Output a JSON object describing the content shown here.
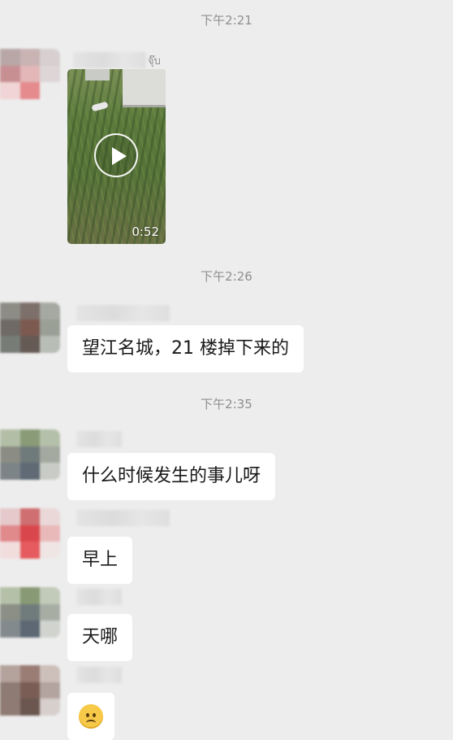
{
  "chat": {
    "timestamps": [
      "下午2:21",
      "下午2:26",
      "下午2:35"
    ],
    "video_message": {
      "sender_tag": "จุ๊บ",
      "duration": "0:52",
      "play_icon": "play-icon"
    },
    "messages": [
      {
        "text": "望江名城，21 楼掉下来的"
      },
      {
        "text": "什么时候发生的事儿呀"
      },
      {
        "text": "早上"
      },
      {
        "text": "天哪"
      },
      {
        "emoji": "sad-face-emoji"
      }
    ]
  },
  "colors": {
    "background": "#ededed",
    "bubble": "#ffffff",
    "timestamp": "#8f8f8f",
    "text": "#191919"
  }
}
